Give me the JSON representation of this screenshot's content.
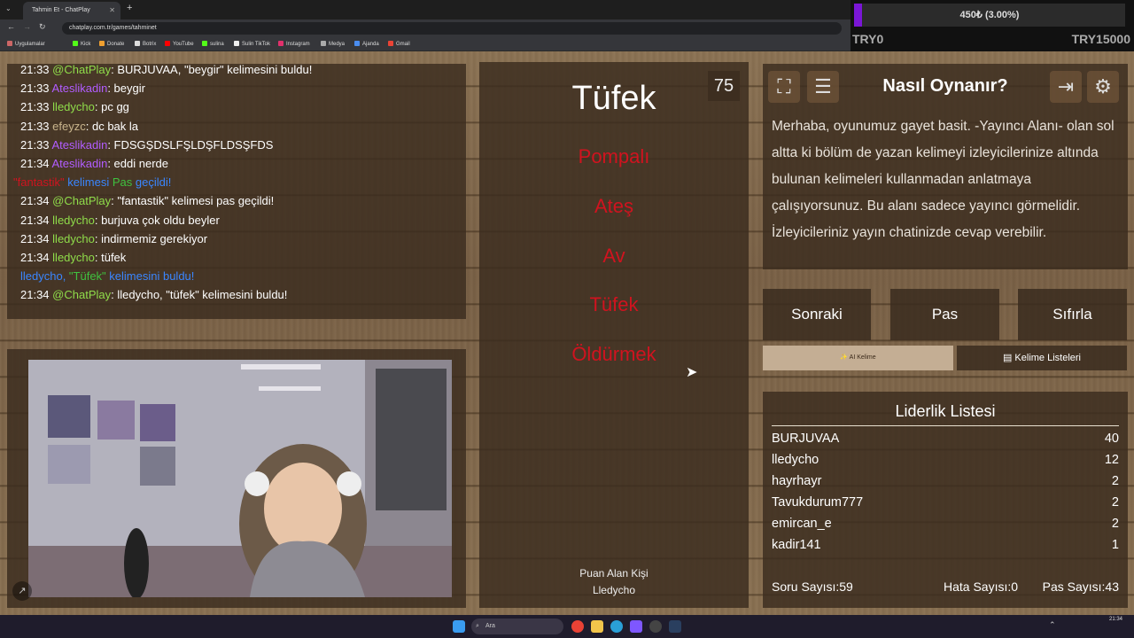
{
  "browser": {
    "tab_title": "Tahmin Et - ChatPlay",
    "url": "chatplay.com.tr/games/tahminet",
    "bookmarks": [
      "Uygulamalar",
      "Kick",
      "Donate",
      "Botrix",
      "YouTube",
      "sulina",
      "Sulin TikTok",
      "Instagram",
      "Medya",
      "Ajanda",
      "Gmail"
    ]
  },
  "donation": {
    "label": "450₺ (3.00%)",
    "left_label": "TRY0",
    "right_label": "TRY15000",
    "progress_percent": 3
  },
  "chat": {
    "messages": [
      {
        "time": "21:33",
        "user": "@ChatPlay",
        "text": ": BURJUVAA, \"beygir\" kelimesini buldu!"
      },
      {
        "time": "21:33",
        "user": "Ateslikadin",
        "text": ": beygir"
      },
      {
        "time": "21:33",
        "user": "lledycho",
        "text": ": pc gg"
      },
      {
        "time": "21:33",
        "user": "efeyzc",
        "text": ": dc bak la"
      },
      {
        "time": "21:33",
        "user": "Ateslikadin",
        "text": ": FDSGŞDSLFŞLDŞFLDSŞFDS"
      },
      {
        "time": "21:34",
        "user": "Ateslikadin",
        "text": ": eddi nerde"
      },
      {
        "system_a": "\"fantastik\"",
        "system_b": " kelimesi ",
        "system_c": "Pas",
        "system_d": " geçildi!"
      },
      {
        "time": "21:34",
        "user": "@ChatPlay",
        "text": ": \"fantastik\" kelimesi pas geçildi!"
      },
      {
        "time": "21:34",
        "user": "lledycho",
        "text": ": burjuva çok oldu beyler"
      },
      {
        "time": "21:34",
        "user": "lledycho",
        "text": ": indirmemiz gerekiyor"
      },
      {
        "time": "21:34",
        "user": "lledycho",
        "text": ": tüfek"
      },
      {
        "found_user": "lledycho, ",
        "found_word": "\"Tüfek\"",
        "found_rest": " kelimesini buldu!"
      },
      {
        "time": "21:34",
        "user": "@ChatPlay",
        "text": ": lledycho, \"tüfek\" kelimesini buldu!"
      }
    ]
  },
  "game": {
    "score": "75",
    "word": "Tüfek",
    "forbidden": [
      "Pompalı",
      "Ateş",
      "Av",
      "Tüfek",
      "Öldürmek"
    ],
    "scorer_label": "Puan Alan Kişi",
    "scorer_name": "Lledycho"
  },
  "howto": {
    "title": "Nasıl Oynanır?",
    "text": "Merhaba, oyunumuz gayet basit. -Yayıncı Alanı- olan sol altta ki bölüm de yazan kelimeyi izleyicilerinize altında bulunan kelimeleri kullanmadan anlatmaya çalışıyorsunuz. Bu alanı sadece yayıncı görmelidir. İzleyicileriniz yayın chatinizde cevap verebilir."
  },
  "controls": {
    "next": "Sonraki",
    "pass": "Pas",
    "reset": "Sıfırla",
    "ai": "AI Kelime",
    "lists": "Kelime Listeleri"
  },
  "leaderboard": {
    "title": "Liderlik Listesi",
    "rows": [
      {
        "name": "BURJUVAA",
        "score": "40"
      },
      {
        "name": "lledycho",
        "score": "12"
      },
      {
        "name": "hayrhayr",
        "score": "2"
      },
      {
        "name": "Tavukdurum777",
        "score": "2"
      },
      {
        "name": "emircan_e",
        "score": "2"
      },
      {
        "name": "kadir141",
        "score": "1"
      }
    ],
    "questions": "Soru Sayısı:59",
    "errors": "Hata Sayısı:0",
    "passes": "Pas Sayısı:43"
  },
  "taskbar": {
    "search": "Ara",
    "clock": "21:34"
  },
  "colors": {
    "chatplay": "#8fdc4a",
    "ateslikadin": "#b15cff",
    "lledycho": "#8fdc4a",
    "efeyzc": "#c8b48c",
    "forbidden": "#d0131f",
    "pas_green": "#3fc13f",
    "found_blue": "#3a86ff",
    "donation_fill": "#7a16d6"
  }
}
